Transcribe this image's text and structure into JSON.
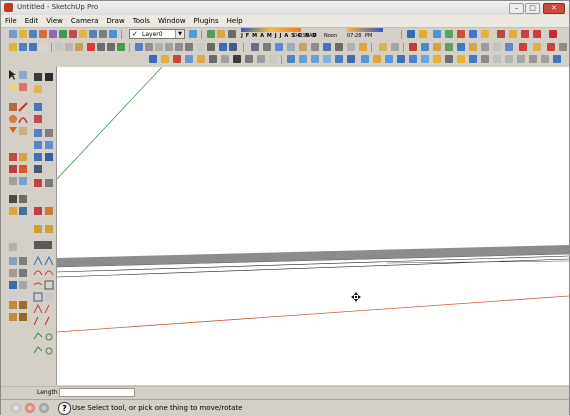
{
  "window": {
    "title": "Untitled - SketchUp Pro",
    "minimize_glyph": "–",
    "maximize_glyph": "□",
    "close_glyph": "✕"
  },
  "menu": {
    "items": [
      "File",
      "Edit",
      "View",
      "Camera",
      "Draw",
      "Tools",
      "Window",
      "Plugins",
      "Help"
    ]
  },
  "layers": {
    "current_layer": "Layer0",
    "check_glyph": "✓",
    "dropdown_glyph": "▼"
  },
  "shadows": {
    "months": "J F M A M J J A S O N D",
    "time_start": "04:37",
    "time_am_label": "AM",
    "time_noon": "Noon",
    "time_end": "07:28",
    "time_pm_label": "PM"
  },
  "vcb": {
    "label": "Length",
    "value": ""
  },
  "status": {
    "help_glyph": "?",
    "message": "Use Select tool, or pick one thing to move/rotate"
  },
  "colors": {
    "axis_green": "#3f9b4b",
    "axis_red": "#c75a3a",
    "surface_gray": "#8c8c8c",
    "accent_red": "#c74a3a"
  },
  "icons": {
    "cursor": "move-cursor-icon"
  }
}
